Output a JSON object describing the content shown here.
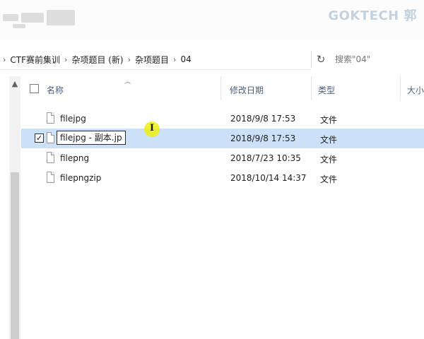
{
  "window": {
    "watermark": "GOKTECH 郭"
  },
  "address_bar": {
    "breadcrumbs": [
      "CTF赛前集训",
      "杂项题目 (新)",
      "杂项题目",
      "04"
    ],
    "separator": "›",
    "refresh_icon": "refresh-icon"
  },
  "search": {
    "placeholder": "搜索\"04\""
  },
  "columns": {
    "name": "名称",
    "date_modified": "修改日期",
    "type": "类型",
    "size": "大小"
  },
  "files": [
    {
      "name": "filejpg",
      "date": "2018/9/8 17:53",
      "type": "文件",
      "selected": false,
      "renaming": false
    },
    {
      "name": "filejpg - 副本.jp",
      "date": "2018/9/8 17:53",
      "type": "文件",
      "selected": true,
      "renaming": true
    },
    {
      "name": "filepng",
      "date": "2018/7/23 10:35",
      "type": "文件",
      "selected": false,
      "renaming": false
    },
    {
      "name": "filepngzip",
      "date": "2018/10/14 14:37",
      "type": "文件",
      "selected": false,
      "renaming": false
    }
  ],
  "icons": {
    "sort": "sort-up-icon",
    "scroll_up": "scroll-up-icon",
    "file": "file-icon",
    "checkbox": "checkbox-icon",
    "cursor": "text-cursor-icon"
  },
  "colors": {
    "selection": "#cce1f7",
    "header_text": "#4c607a",
    "cursor_highlight": "#eeee14",
    "watermark": "#c3d2e0"
  }
}
